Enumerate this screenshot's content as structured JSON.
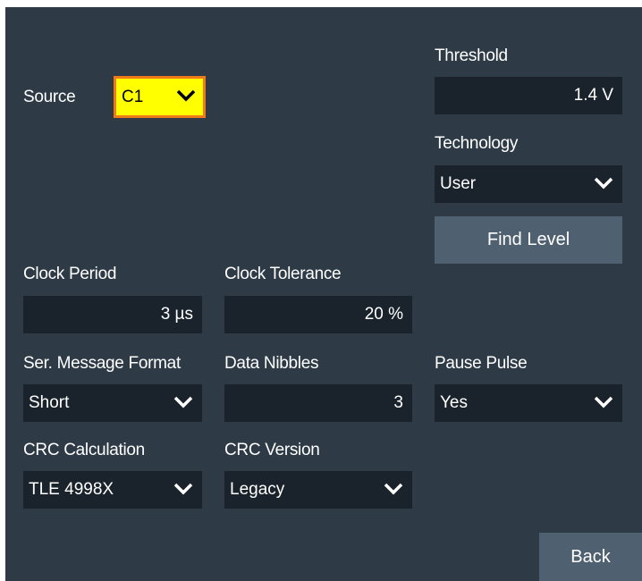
{
  "source": {
    "label": "Source",
    "value": "C1"
  },
  "threshold": {
    "label": "Threshold",
    "value": "1.4 V"
  },
  "technology": {
    "label": "Technology",
    "value": "User"
  },
  "find_level": {
    "label": "Find Level"
  },
  "clock_period": {
    "label": "Clock Period",
    "value": "3 µs"
  },
  "clock_tolerance": {
    "label": "Clock Tolerance",
    "value": "20 %"
  },
  "ser_message_format": {
    "label": "Ser. Message Format",
    "value": "Short"
  },
  "data_nibbles": {
    "label": "Data Nibbles",
    "value": "3"
  },
  "pause_pulse": {
    "label": "Pause Pulse",
    "value": "Yes"
  },
  "crc_calculation": {
    "label": "CRC Calculation",
    "value": "TLE 4998X"
  },
  "crc_version": {
    "label": "CRC Version",
    "value": "Legacy"
  },
  "back": {
    "label": "Back"
  },
  "colors": {
    "panel_bg": "#2e3b46",
    "field_bg": "#1a232b",
    "button_bg": "#4f6070",
    "source_highlight": "#ffff00",
    "source_border": "#ef7a1a"
  },
  "icons": {
    "dropdown": "chevron-down-icon"
  }
}
